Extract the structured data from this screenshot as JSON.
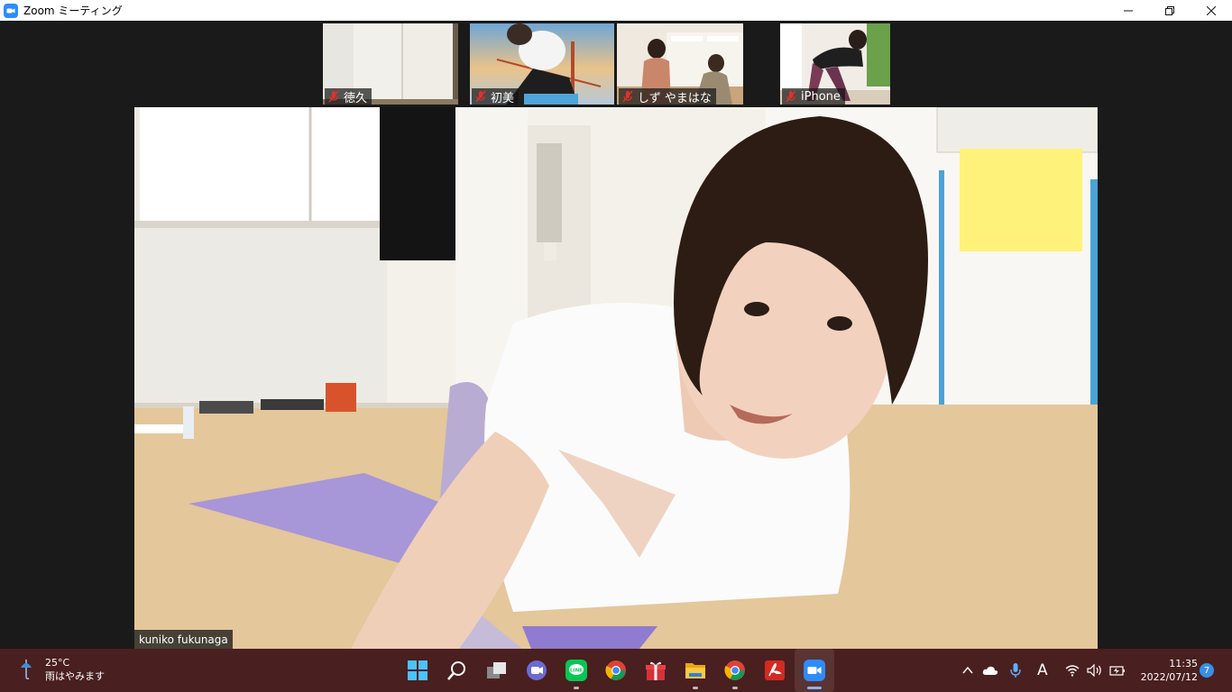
{
  "window": {
    "title": "Zoom ミーティング",
    "controls": {
      "minimize": "—",
      "restore": "❐",
      "close": "✕"
    }
  },
  "thumbnails": [
    {
      "name": "徳久",
      "muted": true
    },
    {
      "name": "初美",
      "muted": true
    },
    {
      "name": "しず やまはな",
      "muted": true
    },
    {
      "name": "iPhone",
      "muted": true
    }
  ],
  "active_speaker": {
    "name": "kuniko fukunaga"
  },
  "taskbar": {
    "weather": {
      "temp": "25°C",
      "desc": "雨はやみます"
    },
    "apps": [
      "windows-start",
      "search",
      "task-view",
      "teams-chat",
      "line",
      "chrome",
      "gift",
      "file-explorer",
      "chrome-2",
      "acrobat",
      "zoom"
    ],
    "tray_input_indicator": "A",
    "clock": {
      "time": "11:35",
      "date": "2022/07/12"
    },
    "notification_count": "7"
  },
  "colors": {
    "zoom_blue": "#2d8cff",
    "taskbar": "#4a1f1f",
    "mute_red": "#e0312b"
  }
}
